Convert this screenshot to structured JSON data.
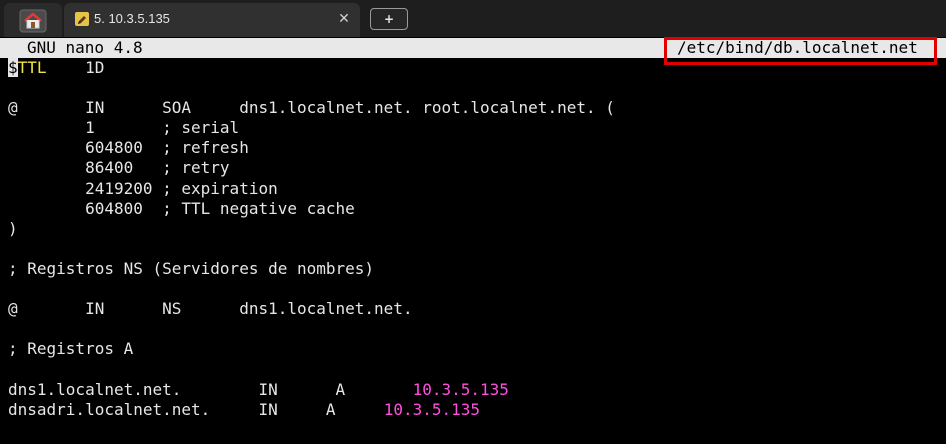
{
  "tabs": {
    "home_icon": "home-icon",
    "session_icon": "pencil-icon",
    "session_title": "5. 10.3.5.135",
    "close_glyph": "✕",
    "new_tab_glyph": "+"
  },
  "nano": {
    "version": "GNU nano 4.8",
    "filename": "/etc/bind/db.localnet.net"
  },
  "editor": {
    "lines": [
      {
        "cursor": "$",
        "a": "TTL",
        "b": "    1D"
      },
      {
        "text": ""
      },
      {
        "text": "@       IN      SOA     dns1.localnet.net. root.localnet.net. ("
      },
      {
        "text": "        1       ; serial"
      },
      {
        "text": "        604800  ; refresh"
      },
      {
        "text": "        86400   ; retry"
      },
      {
        "text": "        2419200 ; expiration"
      },
      {
        "text": "        604800  ; TTL negative cache"
      },
      {
        "text": ")"
      },
      {
        "text": ""
      },
      {
        "text": "; Registros NS (Servidores de nombres)"
      },
      {
        "text": ""
      },
      {
        "text": "@       IN      NS      dns1.localnet.net."
      },
      {
        "text": ""
      },
      {
        "text": "; Registros A"
      },
      {
        "text": ""
      },
      {
        "pre": "dns1.localnet.net.        IN      A       ",
        "ip": "10.3.5.135"
      },
      {
        "pre": "dnsadri.localnet.net.     IN     A     ",
        "ip": "10.3.5.135"
      }
    ]
  },
  "colors": {
    "terminal_bg": "#000000",
    "text": "#e6e6e6",
    "titlebar_bg": "#e8e8e8",
    "highlight_box": "#e00000",
    "ip_color": "#ff4fe0",
    "ttl_color": "#f0e442"
  }
}
